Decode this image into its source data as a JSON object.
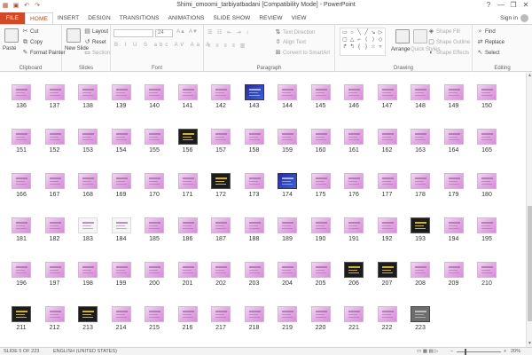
{
  "window": {
    "title": "Shimi_omoomi_tarbiyatbadani [Compatibility Mode] - PowerPoint",
    "help": "?",
    "minimize": "—",
    "restore": "❐",
    "close": "✕"
  },
  "qat": {
    "save": "▣",
    "undo": "↶",
    "redo": "↷",
    "start": "▦"
  },
  "tabs": [
    "FILE",
    "HOME",
    "INSERT",
    "DESIGN",
    "TRANSITIONS",
    "ANIMATIONS",
    "SLIDE SHOW",
    "REVIEW",
    "VIEW"
  ],
  "active_tab": "HOME",
  "signin": "Sign in",
  "ribbon": {
    "clipboard": {
      "paste": "Paste",
      "cut": "Cut",
      "copy": "Copy",
      "format_painter": "Format Painter",
      "label": "Clipboard"
    },
    "slides": {
      "new_slide": "New Slide",
      "layout": "Layout",
      "reset": "Reset",
      "section": "Section",
      "label": "Slides"
    },
    "font": {
      "size": "24",
      "label": "Font"
    },
    "paragraph": {
      "text_direction": "Text Direction",
      "align_text": "Align Text",
      "convert_smartart": "Convert to SmartArt",
      "label": "Paragraph"
    },
    "drawing": {
      "arrange": "Arrange",
      "quick_styles": "Quick Styles",
      "shape_fill": "Shape Fill",
      "shape_outline": "Shape Outline",
      "shape_effects": "Shape Effects",
      "label": "Drawing"
    },
    "editing": {
      "find": "Find",
      "replace": "Replace",
      "select": "Select",
      "label": "Editing"
    }
  },
  "slides": {
    "numbers": [
      136,
      137,
      138,
      139,
      140,
      141,
      142,
      143,
      144,
      145,
      146,
      147,
      148,
      149,
      150,
      151,
      152,
      153,
      154,
      155,
      156,
      157,
      158,
      159,
      160,
      161,
      162,
      163,
      164,
      165,
      166,
      167,
      168,
      169,
      170,
      171,
      172,
      173,
      174,
      175,
      176,
      177,
      178,
      179,
      180,
      181,
      182,
      183,
      184,
      185,
      186,
      187,
      188,
      189,
      190,
      191,
      192,
      193,
      194,
      195,
      196,
      197,
      198,
      199,
      200,
      201,
      202,
      203,
      204,
      205,
      206,
      207,
      208,
      209,
      210,
      211,
      212,
      213,
      214,
      215,
      216,
      217,
      218,
      219,
      220,
      221,
      222,
      223
    ],
    "dark": [
      156,
      172,
      183,
      193,
      206,
      207,
      211,
      213
    ],
    "blue": [
      143,
      174
    ],
    "white": [
      183,
      184
    ],
    "gray": [
      223
    ]
  },
  "status": {
    "slide_info": "SLIDE 5 OF 223",
    "language": "ENGLISH (UNITED STATES)",
    "zoom": "20%"
  },
  "colors": {
    "file_tab": "#d24726",
    "accent": "#b7472a",
    "thumb_pink": "#e2a8e3"
  }
}
